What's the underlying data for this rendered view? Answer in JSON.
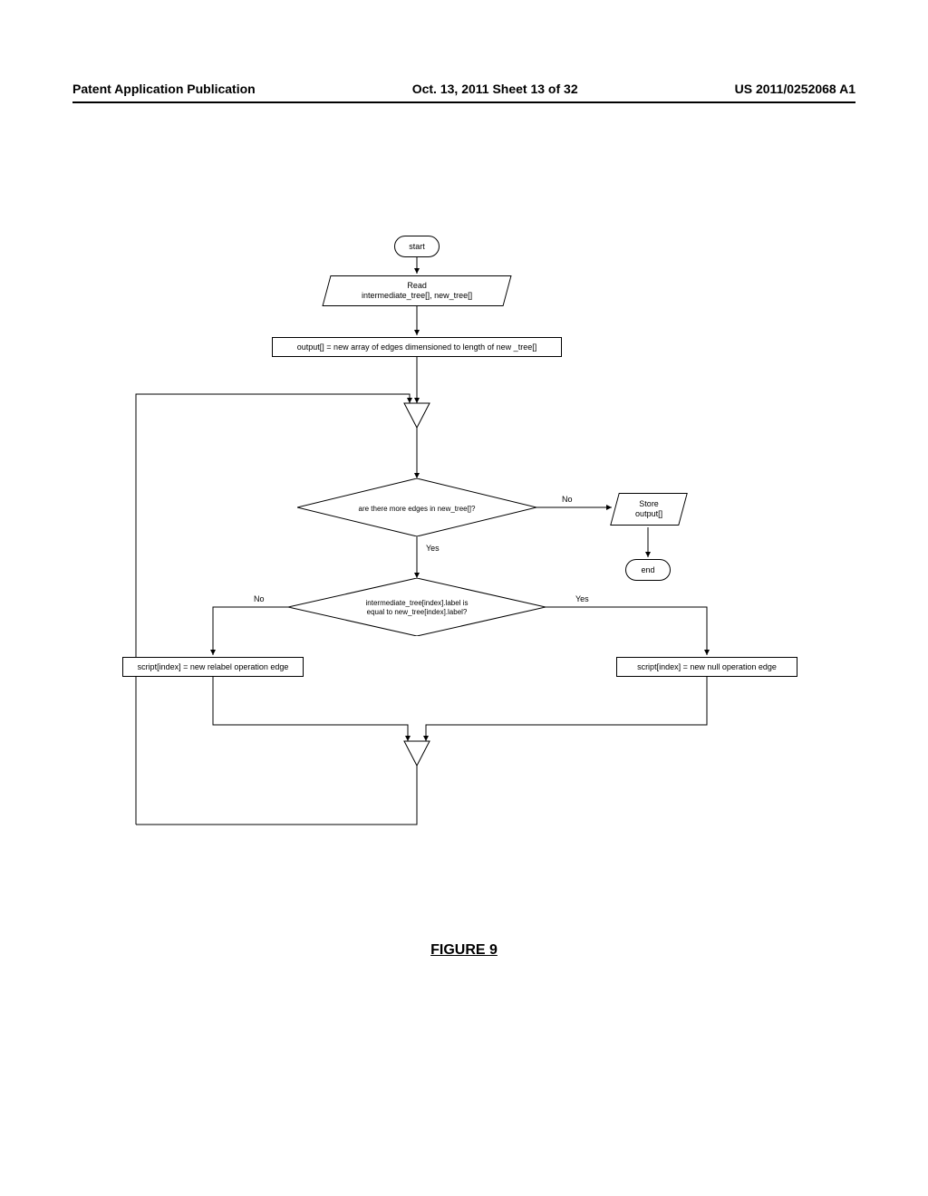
{
  "header": {
    "left": "Patent Application Publication",
    "center": "Oct. 13, 2011  Sheet 13 of 32",
    "right": "US 2011/0252068 A1"
  },
  "nodes": {
    "start": "start",
    "read": "Read\nintermediate_tree[], new_tree[]",
    "init": "output[] = new array of edges dimensioned to length of new _tree[]",
    "dec1": "are there more edges in new_tree[]?",
    "store": "Store\noutput[]",
    "end": "end",
    "dec2": "intermediate_tree[index].label is\nequal to new_tree[index].label?",
    "relabel": "script[index] = new relabel operation edge",
    "nullop": "script[index] = new null operation edge"
  },
  "labels": {
    "no": "No",
    "yes": "Yes"
  },
  "caption": "FIGURE 9"
}
